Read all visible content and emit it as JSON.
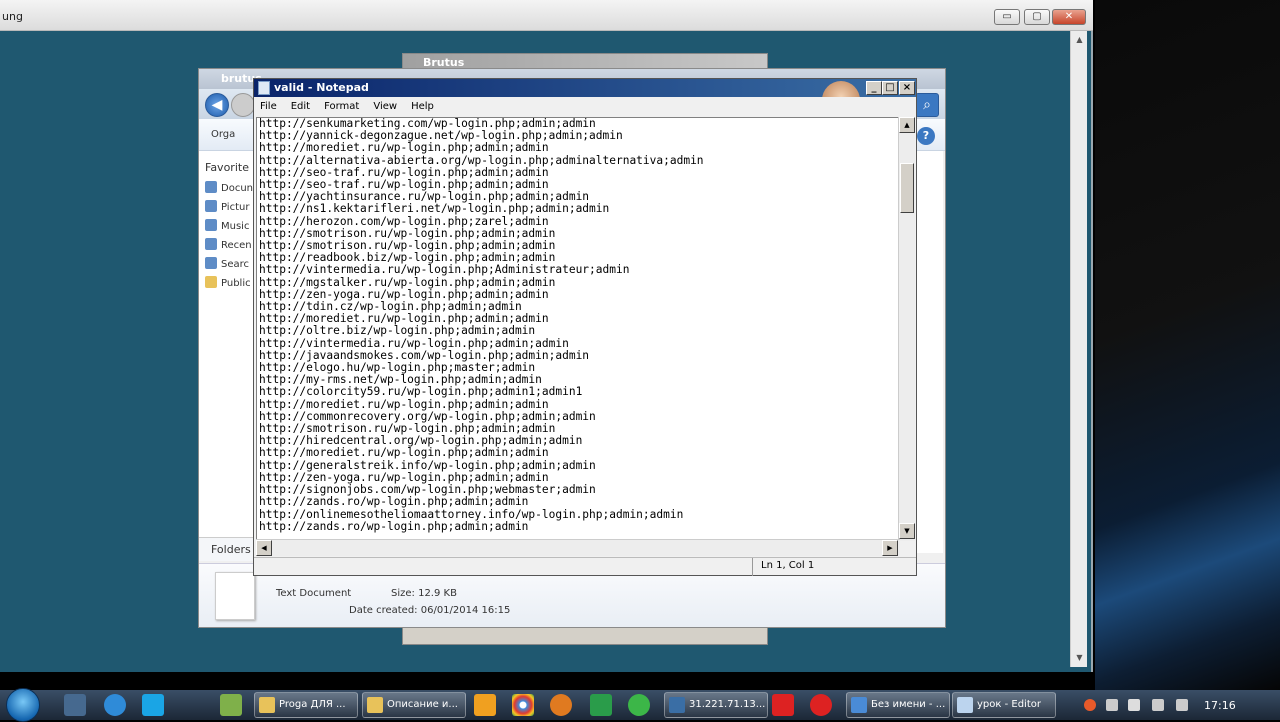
{
  "outer_window": {
    "title": "ung",
    "min": "▭",
    "max": "▢",
    "close": "✕"
  },
  "brutus_back": {
    "title": "Brutus"
  },
  "brutus_front": {
    "title": "brutus",
    "toolbar_label": "Orga",
    "sidebar_header": "Favorite",
    "sidebar_items": [
      "Docun",
      "Pictur",
      "Music",
      "Recen",
      "Searc",
      "Public"
    ],
    "folders_label": "Folders",
    "details": {
      "type": "Text Document",
      "size": "Size: 12.9 KB",
      "date_created": "Date created: 06/01/2014 16:15"
    }
  },
  "notepad": {
    "title": "valid - Notepad",
    "menu": [
      "File",
      "Edit",
      "Format",
      "View",
      "Help"
    ],
    "status": "Ln 1, Col 1",
    "lines": [
      "http://senkumarketing.com/wp-login.php;admin;admin",
      "http://yannick-degonzague.net/wp-login.php;admin;admin",
      "http://morediet.ru/wp-login.php;admin;admin",
      "http://alternativa-abierta.org/wp-login.php;adminalternativa;admin",
      "http://seo-traf.ru/wp-login.php;admin;admin",
      "http://seo-traf.ru/wp-login.php;admin;admin",
      "http://yachtinsurance.ru/wp-login.php;admin;admin",
      "http://ns1.kektarifleri.net/wp-login.php;admin;admin",
      "http://herozon.com/wp-login.php;zarel;admin",
      "http://smotrison.ru/wp-login.php;admin;admin",
      "http://smotrison.ru/wp-login.php;admin;admin",
      "http://readbook.biz/wp-login.php;admin;admin",
      "http://vintermedia.ru/wp-login.php;Administrateur;admin",
      "http://mgstalker.ru/wp-login.php;admin;admin",
      "http://zen-yoga.ru/wp-login.php;admin;admin",
      "http://tdin.cz/wp-login.php;admin;admin",
      "http://morediet.ru/wp-login.php;admin;admin",
      "http://oltre.biz/wp-login.php;admin;admin",
      "http://vintermedia.ru/wp-login.php;admin;admin",
      "http://javaandsmokes.com/wp-login.php;admin;admin",
      "http://elogo.hu/wp-login.php;master;admin",
      "http://my-rms.net/wp-login.php;admin;admin",
      "http://colorcity59.ru/wp-login.php;admin1;admin1",
      "http://morediet.ru/wp-login.php;admin;admin",
      "http://commonrecovery.org/wp-login.php;admin;admin",
      "http://smotrison.ru/wp-login.php;admin;admin",
      "http://hiredcentral.org/wp-login.php;admin;admin",
      "http://morediet.ru/wp-login.php;admin;admin",
      "http://generalstreik.info/wp-login.php;admin;admin",
      "http://zen-yoga.ru/wp-login.php;admin;admin",
      "http://signonjobs.com/wp-login.php;webmaster;admin",
      "http://zands.ro/wp-login.php;admin;admin",
      "http://onlinemesotheliomaattorney.info/wp-login.php;admin;admin",
      "http://zands.ro/wp-login.php;admin;admin"
    ]
  },
  "taskbar": {
    "tasks": [
      {
        "label": "Proga ДЛЯ ...",
        "color": "#e8c25a"
      },
      {
        "label": "Описание и...",
        "color": "#e8c25a"
      },
      {
        "label": "31.221.71.13...",
        "color": "#3a6ea5"
      },
      {
        "label": "Без имени - ...",
        "color": "#4a8bd6"
      },
      {
        "label": "урок - Editor",
        "color": "#bcd4ee"
      }
    ],
    "clock": "17:16"
  }
}
